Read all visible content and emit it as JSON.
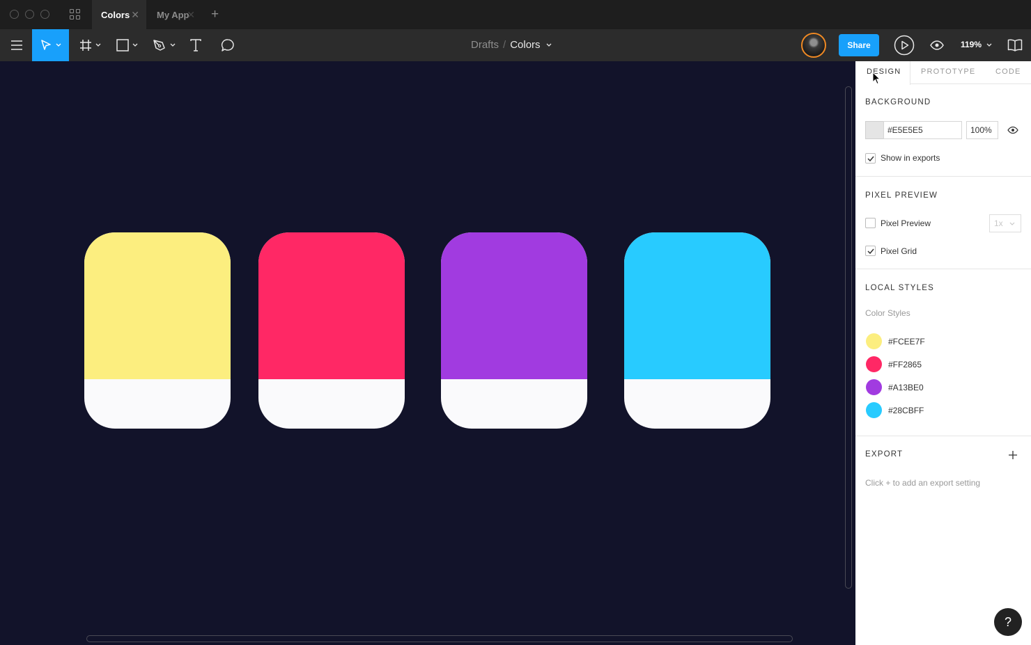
{
  "tabs": [
    {
      "label": "Colors",
      "active": true
    },
    {
      "label": "My App",
      "active": false
    }
  ],
  "toolbar": {
    "breadcrumb_root": "Drafts",
    "breadcrumb_separator": "/",
    "breadcrumb_current": "Colors",
    "share_label": "Share",
    "zoom": "119%"
  },
  "canvas": {
    "swatches": [
      {
        "name": "yellow",
        "color": "#FCEE7F"
      },
      {
        "name": "red",
        "color": "#FF2865"
      },
      {
        "name": "purple",
        "color": "#A13BE0"
      },
      {
        "name": "blue",
        "color": "#28CBFF"
      }
    ]
  },
  "panel": {
    "tabs": [
      "DESIGN",
      "PROTOTYPE",
      "CODE"
    ],
    "background": {
      "title": "BACKGROUND",
      "hex": "#E5E5E5",
      "opacity": "100%",
      "show_in_exports_label": "Show in exports",
      "show_in_exports_checked": true
    },
    "pixel_preview": {
      "title": "PIXEL PREVIEW",
      "preview_label": "Pixel Preview",
      "preview_checked": false,
      "scale": "1x",
      "grid_label": "Pixel Grid",
      "grid_checked": true
    },
    "local_styles": {
      "title": "LOCAL STYLES",
      "subtitle": "Color Styles",
      "colors": [
        "#FCEE7F",
        "#FF2865",
        "#A13BE0",
        "#28CBFF"
      ]
    },
    "export": {
      "title": "EXPORT",
      "hint": "Click + to add an export setting"
    }
  },
  "help": "?"
}
